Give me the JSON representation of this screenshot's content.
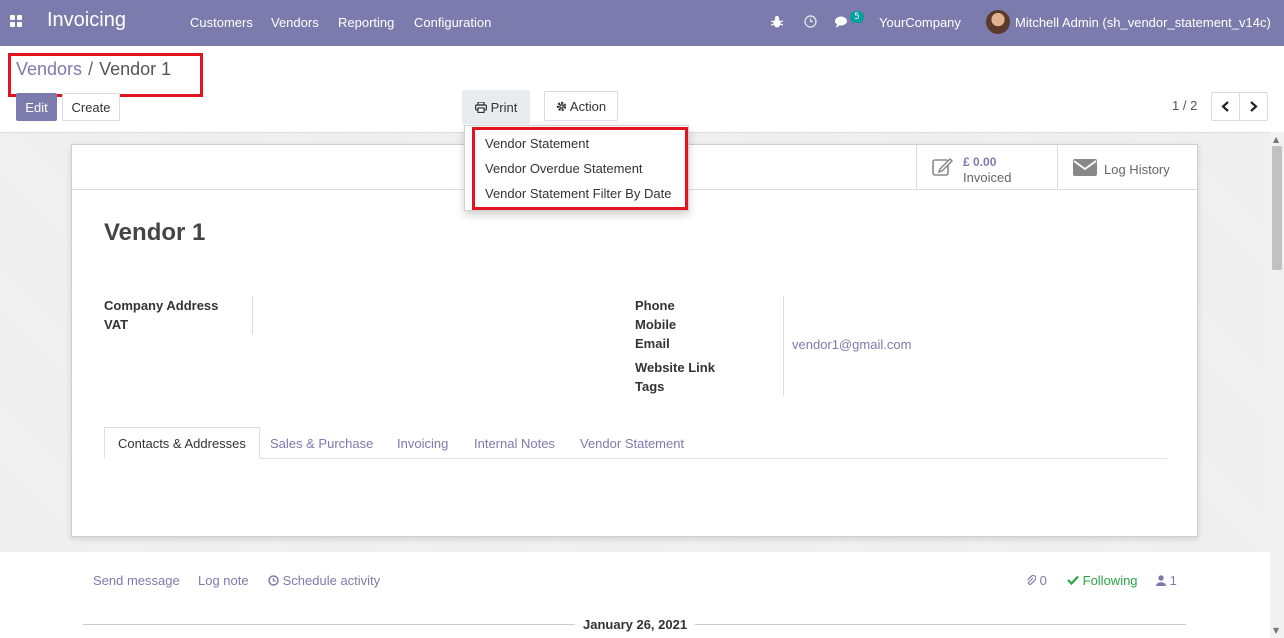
{
  "navbar": {
    "app_name": "Invoicing",
    "menu": [
      "Customers",
      "Vendors",
      "Reporting",
      "Configuration"
    ],
    "message_count": "5",
    "company": "YourCompany",
    "user": "Mitchell Admin (sh_vendor_statement_v14c)"
  },
  "breadcrumb": {
    "parent": "Vendors",
    "separator": "/",
    "current": "Vendor 1"
  },
  "toolbar": {
    "edit_label": "Edit",
    "create_label": "Create",
    "print_label": "Print",
    "action_label": "Action",
    "pager": "1 / 2"
  },
  "print_menu": [
    "Vendor Statement",
    "Vendor Overdue Statement",
    "Vendor Statement Filter By Date"
  ],
  "stat_buttons": {
    "invoiced_amount": "£ 0.00",
    "invoiced_label": "Invoiced",
    "log_history_label": "Log History"
  },
  "record": {
    "name": "Vendor 1",
    "left_labels": [
      "Company Address",
      "VAT"
    ],
    "phone_label": "Phone",
    "mobile_label": "Mobile",
    "email_label": "Email",
    "email_value": "vendor1@gmail.com",
    "website_label": "Website Link",
    "tags_label": "Tags"
  },
  "tabs": [
    "Contacts & Addresses",
    "Sales & Purchase",
    "Invoicing",
    "Internal Notes",
    "Vendor Statement"
  ],
  "chatter": {
    "send_message": "Send message",
    "log_note": "Log note",
    "schedule_activity": "Schedule activity",
    "attachments": "0",
    "following": "Following",
    "followers": "1",
    "date": "January 26, 2021"
  },
  "colors": {
    "brand": "#7c7bad",
    "highlight": "#e2141f",
    "following": "#28a745"
  }
}
